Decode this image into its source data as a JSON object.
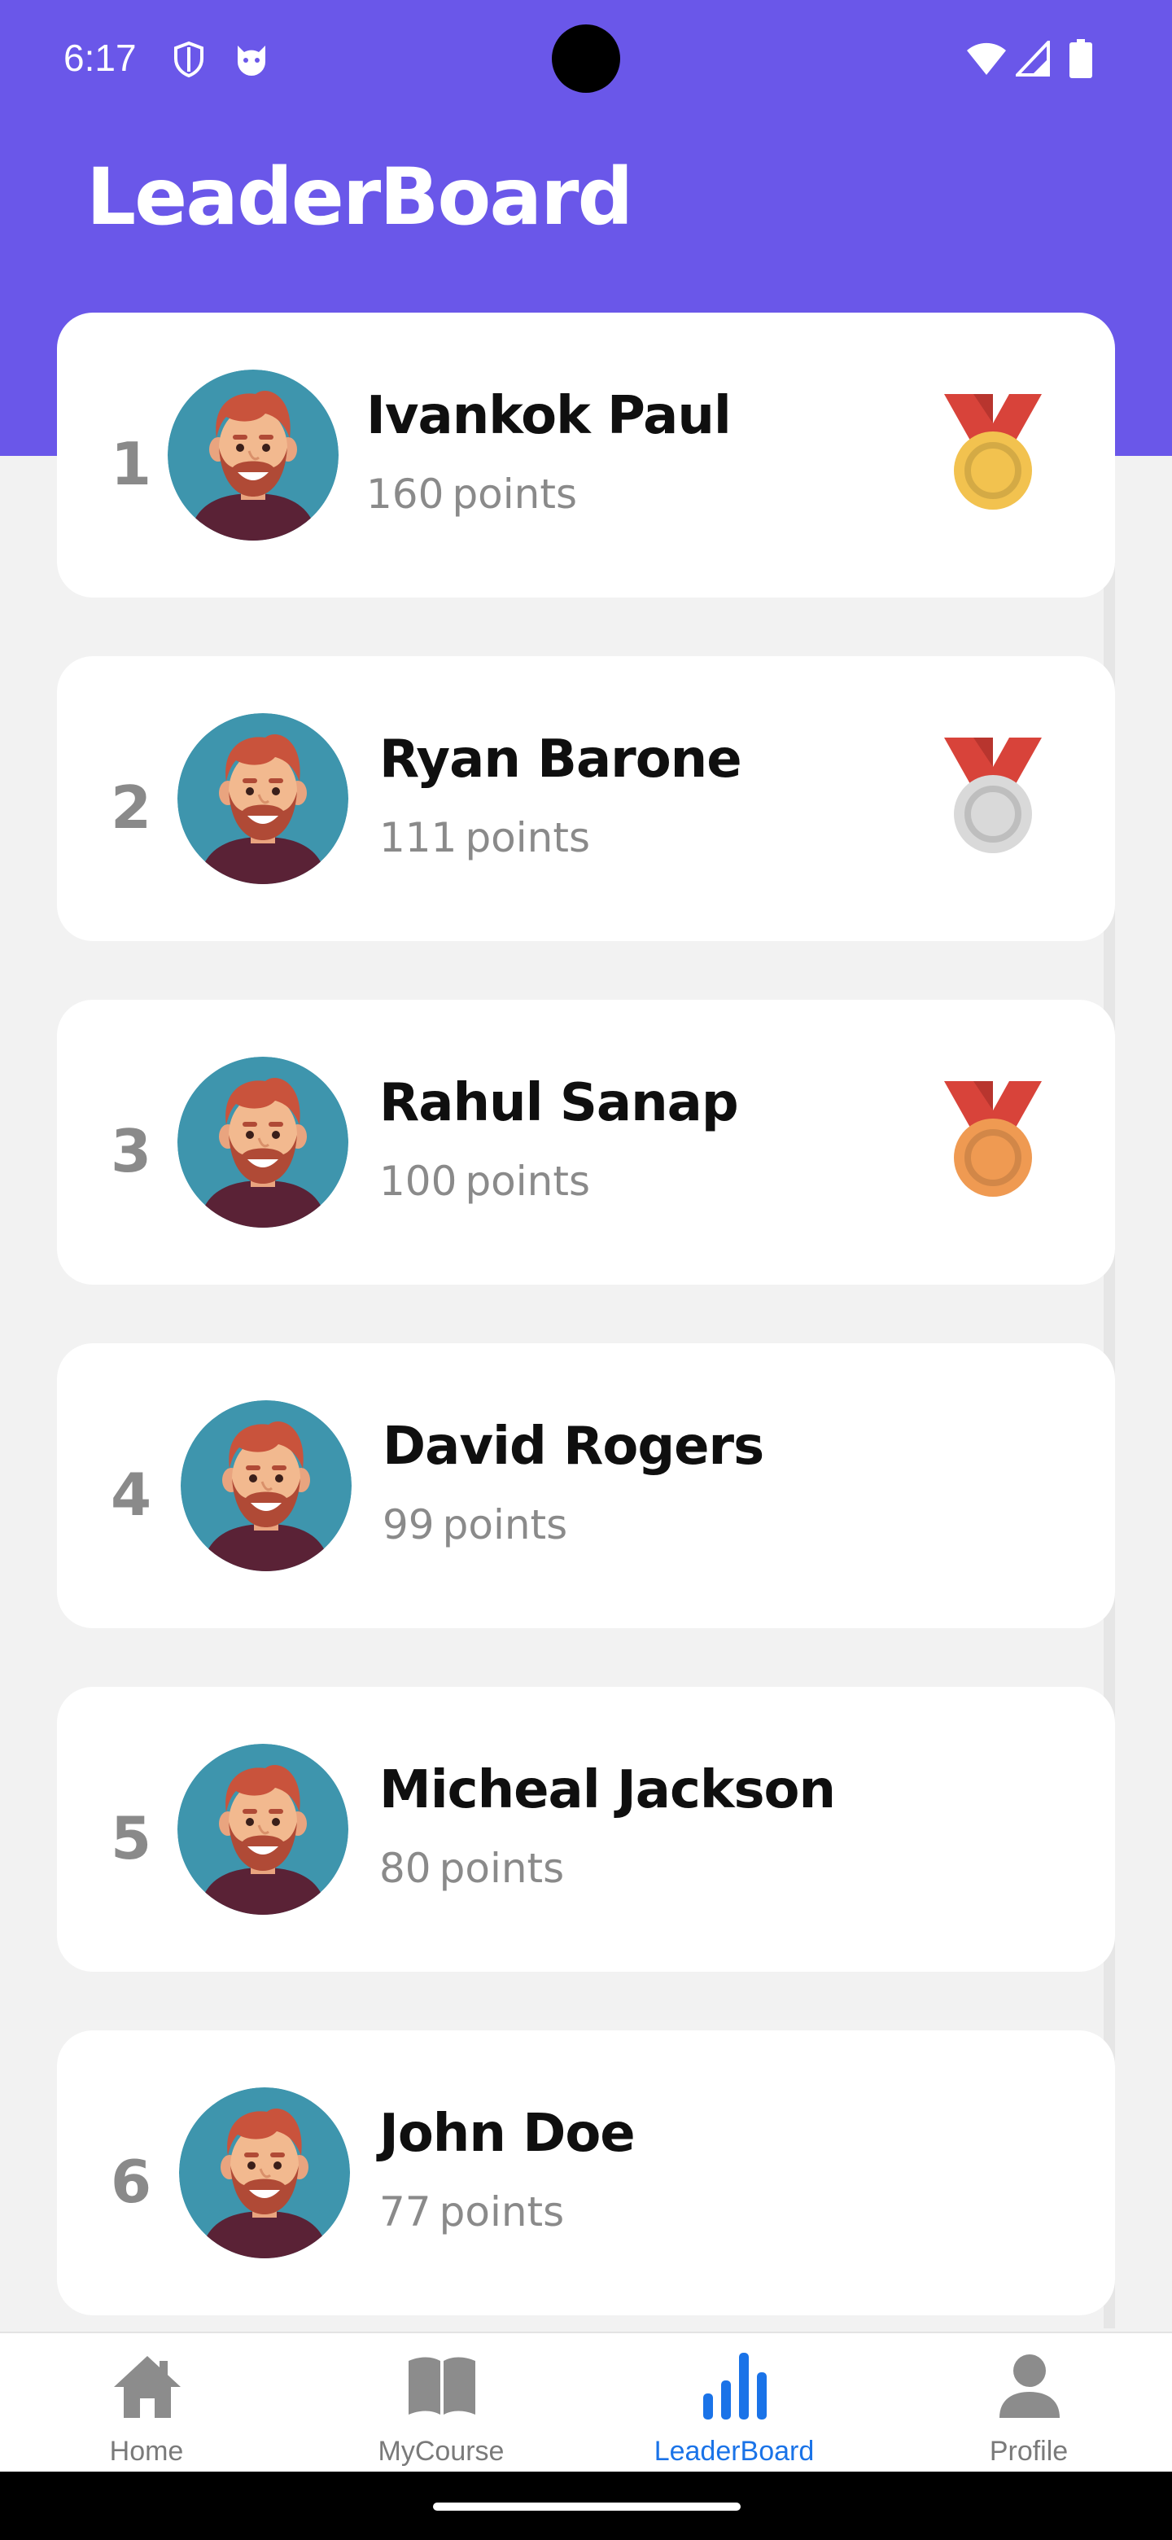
{
  "status_bar": {
    "time": "6:17"
  },
  "header": {
    "title": "LeaderBoard"
  },
  "points_suffix": "points",
  "leaders": [
    {
      "rank": "1",
      "name": "Ivankok Paul",
      "points": "160",
      "medal": "gold-medal-icon"
    },
    {
      "rank": "2",
      "name": "Ryan Barone",
      "points": "111",
      "medal": "silver-medal-icon"
    },
    {
      "rank": "3",
      "name": "Rahul Sanap",
      "points": "100",
      "medal": "bronze-medal-icon"
    },
    {
      "rank": "4",
      "name": "David Rogers",
      "points": "99",
      "medal": null
    },
    {
      "rank": "5",
      "name": "Micheal Jackson",
      "points": "80",
      "medal": null
    },
    {
      "rank": "6",
      "name": "John Doe",
      "points": "77",
      "medal": null
    }
  ],
  "nav": [
    {
      "label": "Home",
      "icon": "home-icon",
      "active": false
    },
    {
      "label": "MyCourse",
      "icon": "book-icon",
      "active": false
    },
    {
      "label": "LeaderBoard",
      "icon": "bar-chart-icon",
      "active": true
    },
    {
      "label": "Profile",
      "icon": "profile-icon",
      "active": false
    }
  ],
  "colors": {
    "header": "#6a57e9",
    "active_nav": "#1a73e8",
    "gold": "#f2c24f",
    "silver": "#d9d9d9",
    "bronze": "#ef9a52",
    "ribbon": "#d8433a"
  }
}
